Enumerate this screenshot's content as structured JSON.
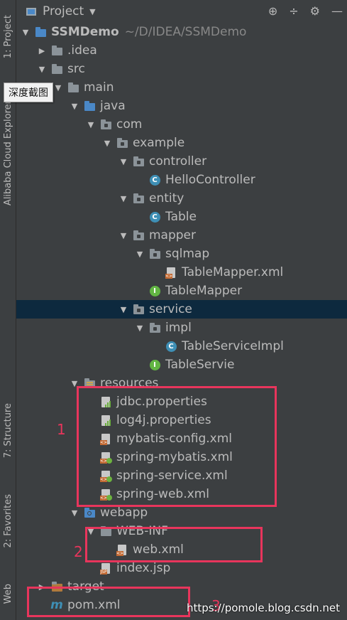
{
  "sidebar": {
    "project_tab": "1: Project",
    "cloud_tab": "Alibaba Cloud Explorer",
    "structure_tab": "7: Structure",
    "favorites_tab": "2: Favorites",
    "web_tab": "Web"
  },
  "header": {
    "title": "Project"
  },
  "tooltip": "深度截图",
  "tree": [
    {
      "name": "SSMDemo",
      "path": "~/D/IDEA/SSMDemo"
    },
    {
      "name": ".idea"
    },
    {
      "name": "src"
    },
    {
      "name": "main"
    },
    {
      "name": "java"
    },
    {
      "name": "com"
    },
    {
      "name": "example"
    },
    {
      "name": "controller"
    },
    {
      "name": "HelloController"
    },
    {
      "name": "entity"
    },
    {
      "name": "Table"
    },
    {
      "name": "mapper"
    },
    {
      "name": "sqlmap"
    },
    {
      "name": "TableMapper.xml"
    },
    {
      "name": "TableMapper"
    },
    {
      "name": "service"
    },
    {
      "name": "impl"
    },
    {
      "name": "TableServiceImpl"
    },
    {
      "name": "TableServie"
    },
    {
      "name": "resources"
    },
    {
      "name": "jdbc.properties"
    },
    {
      "name": "log4j.properties"
    },
    {
      "name": "mybatis-config.xml"
    },
    {
      "name": "spring-mybatis.xml"
    },
    {
      "name": "spring-service.xml"
    },
    {
      "name": "spring-web.xml"
    },
    {
      "name": "webapp"
    },
    {
      "name": "WEB-INF"
    },
    {
      "name": "web.xml"
    },
    {
      "name": "index.jsp"
    },
    {
      "name": "target"
    },
    {
      "name": "pom.xml"
    }
  ],
  "annotations": {
    "mark1": "1",
    "mark2": "2",
    "mark3": "3"
  },
  "watermark": "https://pomole.blog.csdn.net",
  "colors": {
    "selection": "#0d293e",
    "highlight_box": "#e8355c",
    "background": "#3c3f41"
  }
}
